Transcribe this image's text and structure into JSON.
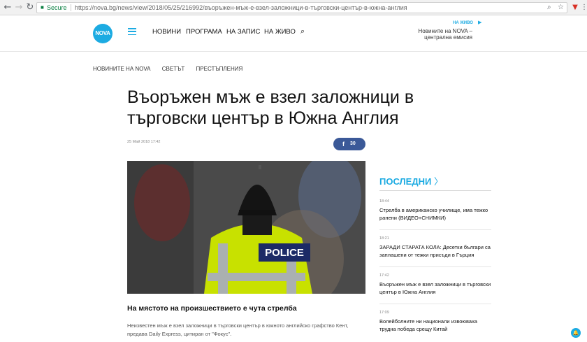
{
  "browser": {
    "back_icon": "←",
    "forward_icon": "→",
    "reload_icon": "↻",
    "secure_label": "Secure",
    "url": "https://nova.bg/news/view/2018/05/25/216992/въоръжен-мъж-е-взел-заложници-в-търговски-център-в-южна-англия",
    "zoom_icon": "⌕",
    "star_icon": "☆"
  },
  "header": {
    "logo_text": "NOVA",
    "menu": [
      "НОВИНИ",
      "ПРОГРАМА",
      "НА ЗАПИС",
      "НА ЖИВО"
    ],
    "live_label": "НА ЖИВО",
    "live_text": "Новините на NOVA – централна емисия"
  },
  "article": {
    "breadcrumb": [
      "НОВИНИТЕ НА NOVA",
      "СВЕТЪТ",
      "ПРЕСТЪПЛЕНИЯ"
    ],
    "title": "Въоръжен мъж е взел заложници в търговски център в Южна Англия",
    "date": "25 Май 2018 17:42",
    "share_count": "30",
    "photo_text": "POLICE",
    "caption": "На мястото на произшествието е чута стрелба",
    "lead": "Неизвестен мъж е взел заложници в търговски център в южното английско графство Кент, предава Daily Express, цитиран от \"Фокус\"."
  },
  "sidebar": {
    "title": "ПОСЛЕДНИ",
    "items": [
      {
        "time": "18:44",
        "text": "Стрелба в американско училище, има тежко ранени (ВИДЕО+СНИМКИ)"
      },
      {
        "time": "18:21",
        "text": "ЗАРАДИ СТАРАТА КОЛА: Десетки българи са заплашени от тежки присъди в Гърция"
      },
      {
        "time": "17:42",
        "text": "Въоръжен мъж е взел заложници в търговски център в Южна Англия"
      },
      {
        "time": "17:09",
        "text": "Волейболните ни национали извоюваха трудна победа срещу Китай"
      }
    ]
  }
}
